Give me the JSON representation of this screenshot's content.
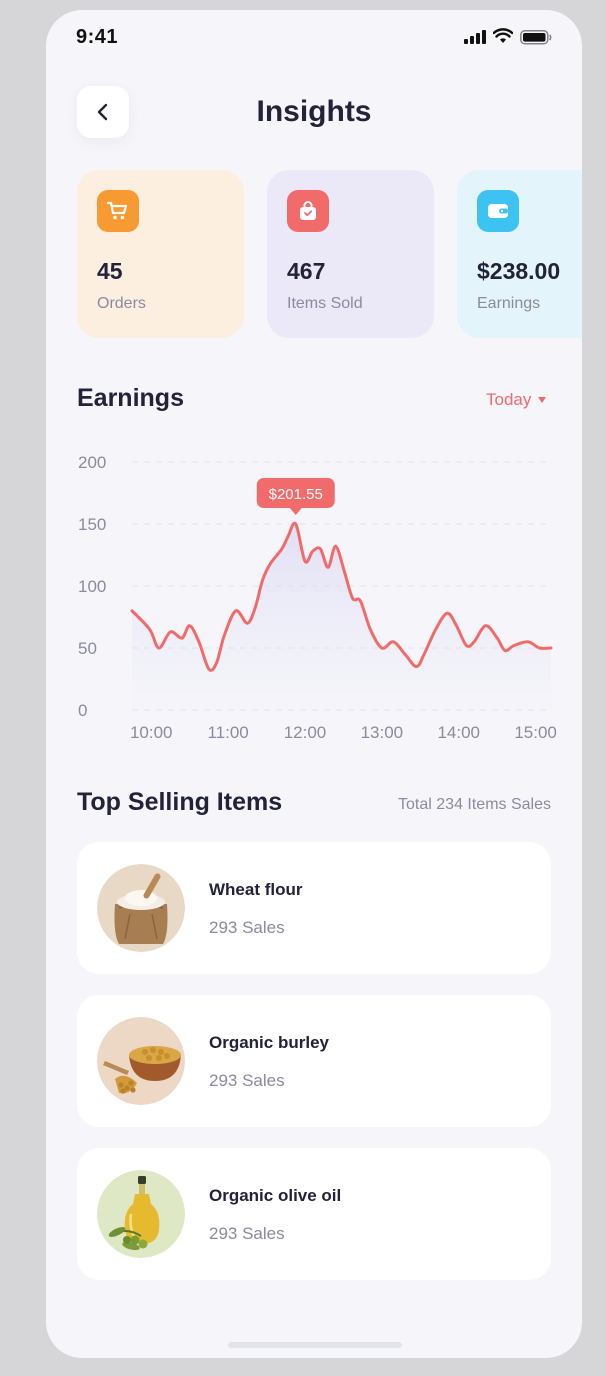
{
  "status_bar": {
    "time": "9:41"
  },
  "header": {
    "title": "Insights"
  },
  "stats": [
    {
      "value": "45",
      "label": "Orders",
      "icon": "cart-icon",
      "color": "#f79a32",
      "bg": "#fcefe0"
    },
    {
      "value": "467",
      "label": "Items Sold",
      "icon": "shopping-bag-icon",
      "color": "#f26b6b",
      "bg": "#ebe9f7"
    },
    {
      "value": "$238.00",
      "label": "Earnings",
      "icon": "wallet-icon",
      "color": "#3cc3f2",
      "bg": "#e3f4fa"
    }
  ],
  "earnings": {
    "title": "Earnings",
    "period": "Today",
    "tooltip": "$201.55"
  },
  "chart_data": {
    "type": "line",
    "title": "Earnings",
    "x_ticks": [
      "10:00",
      "11:00",
      "12:00",
      "13:00",
      "14:00",
      "15:00"
    ],
    "y_ticks": [
      "0",
      "50",
      "100",
      "150",
      "200"
    ],
    "ylim": [
      0,
      200
    ],
    "xlim": [
      9.75,
      15.2
    ],
    "grid": true,
    "color": "#f26b6b",
    "x": [
      9.75,
      9.98,
      10.1,
      10.25,
      10.4,
      10.5,
      10.62,
      10.75,
      10.85,
      10.95,
      11.1,
      11.25,
      11.35,
      11.45,
      11.55,
      11.7,
      11.78,
      11.88,
      12.0,
      12.1,
      12.2,
      12.3,
      12.4,
      12.52,
      12.62,
      12.72,
      12.85,
      13.0,
      13.15,
      13.3,
      13.45,
      13.55,
      13.7,
      13.85,
      13.97,
      14.1,
      14.2,
      14.35,
      14.5,
      14.6,
      14.72,
      14.9,
      15.05,
      15.2
    ],
    "y": [
      80,
      65,
      50,
      63,
      58,
      68,
      55,
      33,
      38,
      60,
      80,
      70,
      82,
      105,
      118,
      130,
      140,
      150,
      120,
      128,
      130,
      115,
      132,
      110,
      90,
      88,
      65,
      50,
      55,
      45,
      35,
      45,
      65,
      78,
      68,
      52,
      55,
      68,
      58,
      48,
      52,
      55,
      50,
      50
    ]
  },
  "top_selling": {
    "title": "Top Selling Items",
    "total": "Total 234 Items Sales",
    "items": [
      {
        "name": "Wheat flour",
        "sales": "293 Sales"
      },
      {
        "name": "Organic burley",
        "sales": "293 Sales"
      },
      {
        "name": "Organic olive oil",
        "sales": "293 Sales"
      }
    ]
  }
}
